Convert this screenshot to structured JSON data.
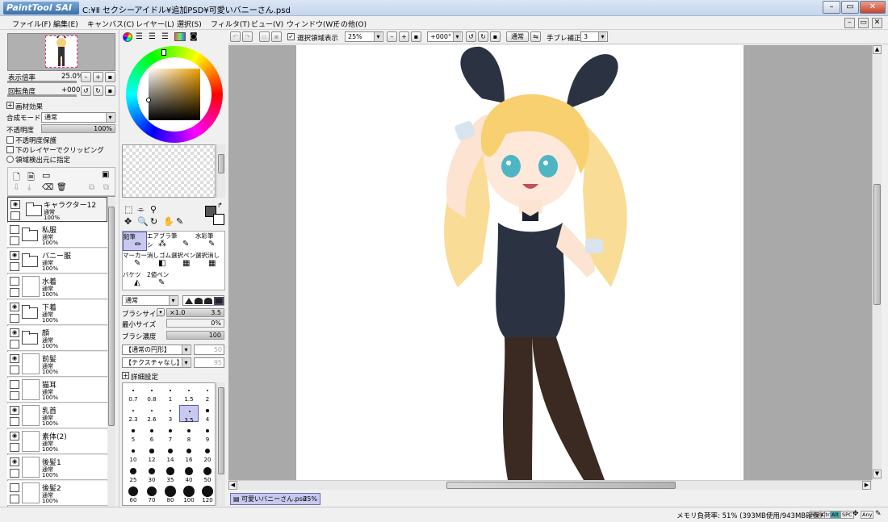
{
  "app": {
    "logo": "PaintTool SAI",
    "title": "C:¥Ⅱ セクシーアイドル¥追加PSD¥可愛いバニーさん.psd"
  },
  "menu": [
    "ファイル(F)",
    "編集(E)",
    "キャンバス(C)",
    "レイヤー(L)",
    "選択(S)",
    "フィルタ(T)",
    "ビュー(V)",
    "ウィンドウ(W)",
    "その他(O)"
  ],
  "navigator": {
    "zoom_label": "表示倍率",
    "zoom_value": "25.0%",
    "rotate_label": "回転角度",
    "rotate_value": "+000°"
  },
  "layer_props": {
    "paper_effect": "画材効果",
    "blend_label": "合成モード",
    "blend_value": "通常",
    "opacity_label": "不透明度",
    "opacity_value": "100%",
    "opacity_fraction": 1.0,
    "check_preserve": "不透明度保護",
    "check_clip": "下のレイヤーでクリッピング",
    "check_source": "領域検出元に指定"
  },
  "layers": [
    {
      "name": "キャラクター12",
      "mode": "通常",
      "opacity": "100%",
      "type": "folder",
      "visible": true
    },
    {
      "name": "私服",
      "mode": "通常",
      "opacity": "100%",
      "type": "folder",
      "visible": false
    },
    {
      "name": "バニー服",
      "mode": "通常",
      "opacity": "100%",
      "type": "folder",
      "visible": true
    },
    {
      "name": "水着",
      "mode": "通常",
      "opacity": "100%",
      "type": "layer",
      "visible": false
    },
    {
      "name": "下着",
      "mode": "通常",
      "opacity": "100%",
      "type": "folder",
      "visible": true
    },
    {
      "name": "顔",
      "mode": "通常",
      "opacity": "100%",
      "type": "folder",
      "visible": true
    },
    {
      "name": "前髪",
      "mode": "通常",
      "opacity": "100%",
      "type": "layer",
      "visible": true
    },
    {
      "name": "猫耳",
      "mode": "通常",
      "opacity": "100%",
      "type": "layer",
      "visible": false
    },
    {
      "name": "乳首",
      "mode": "通常",
      "opacity": "100%",
      "type": "layer",
      "visible": true
    },
    {
      "name": "素体(2)",
      "mode": "通常",
      "opacity": "100%",
      "type": "layer",
      "visible": true
    },
    {
      "name": "後髪1",
      "mode": "通常",
      "opacity": "100%",
      "type": "layer",
      "visible": true
    },
    {
      "name": "後髪2",
      "mode": "通常",
      "opacity": "100%",
      "type": "layer",
      "visible": false
    }
  ],
  "tools": [
    {
      "label": "鉛筆"
    },
    {
      "label": "エアブラシ"
    },
    {
      "label": "筆"
    },
    {
      "label": "水彩筆"
    },
    {
      "label": "マーカー"
    },
    {
      "label": "消しゴム"
    },
    {
      "label": "選択ペン"
    },
    {
      "label": "選択消し"
    },
    {
      "label": "バケツ"
    },
    {
      "label": "2値ペン"
    }
  ],
  "brush": {
    "mode": "通常",
    "size_label": "ブラシサイズ",
    "size_mult": "×1.0",
    "size_value": "3.5",
    "min_label": "最小サイズ",
    "min_value": "0%",
    "density_label": "ブラシ濃度",
    "density_value": "100",
    "shape": "【通常の円形】",
    "shape_val": "50",
    "texture": "【テクスチャなし】",
    "texture_val": "95",
    "detail": "詳細設定",
    "sizes": [
      "0.7",
      "0.8",
      "1",
      "1.5",
      "2",
      "2.3",
      "2.6",
      "3",
      "3.5",
      "4",
      "5",
      "6",
      "7",
      "8",
      "9",
      "10",
      "12",
      "14",
      "16",
      "20",
      "25",
      "30",
      "35",
      "40",
      "50",
      "60",
      "70",
      "80",
      "100",
      "120"
    ],
    "selected_size": "3.5"
  },
  "toolbar": {
    "show_selection": "選択領域表示",
    "zoom": "25%",
    "rotate": "+000°",
    "mode": "通常",
    "stab_label": "手ブレ補正",
    "stab_value": "3"
  },
  "doc_tab": {
    "name": "可愛いバニーさん.psd",
    "zoom": "25%"
  },
  "status": {
    "memory": "メモリ負荷率: 51% (393MB使用/943MB確保)",
    "keys": [
      "Shift",
      "Ctrl",
      "Alt",
      "SPC",
      "Any"
    ]
  },
  "colors": {
    "canvas_bg": "#a9a9a9",
    "selected_tool": "#c9c9f0",
    "doc_tab": "#c9c9f0"
  }
}
